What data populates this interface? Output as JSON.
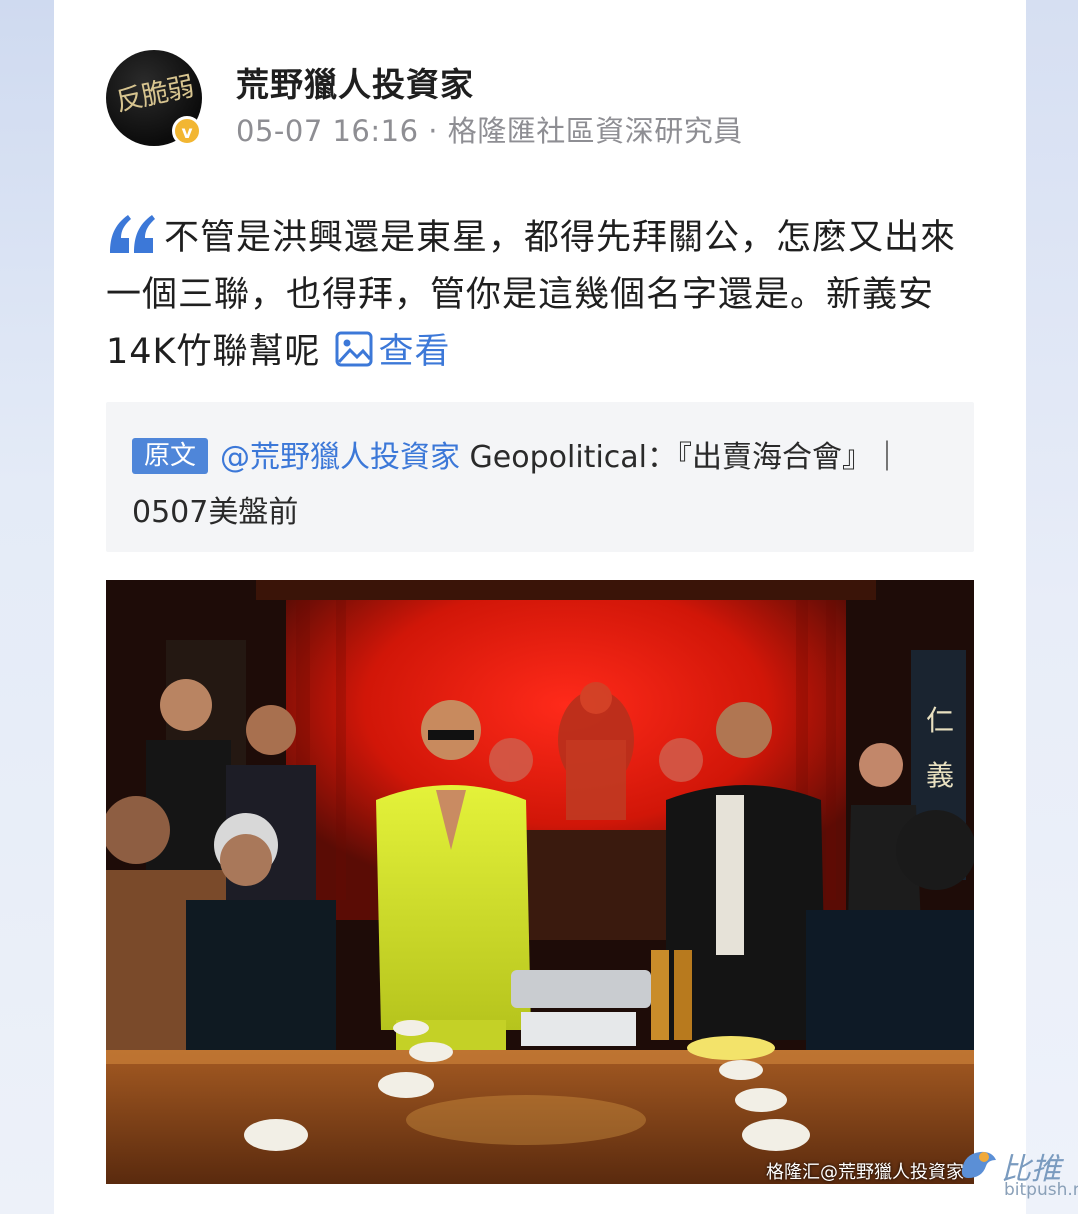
{
  "post": {
    "author": "荒野獵人投資家",
    "avatar_text": "反脆弱",
    "verified_badge": "v",
    "meta": "05-07 16:16 · 格隆匯社區資深研究員",
    "content_text": "不管是洪興還是東星，都得先拜關公，怎麽又出來一個三聯，也得拜，管你是這幾個名字還是。新義安14K竹聯幫呢",
    "view_label": "查看",
    "quote_icon": "quote-icon",
    "image_icon": "image-icon"
  },
  "original": {
    "tag": "原文",
    "mention": "@荒野獵人投資家",
    "text": " Geopolitical：『出賣海合會』｜0507美盤前"
  },
  "photo": {
    "watermark": "格隆汇@荒野獵人投資家",
    "subject": "red-hall-meeting-scene"
  },
  "footer": {
    "brand": "比推",
    "url": "bitpush.news"
  },
  "colors": {
    "accent": "#3c78d8",
    "badge": "#f2b632",
    "tag": "#4f86d9"
  }
}
